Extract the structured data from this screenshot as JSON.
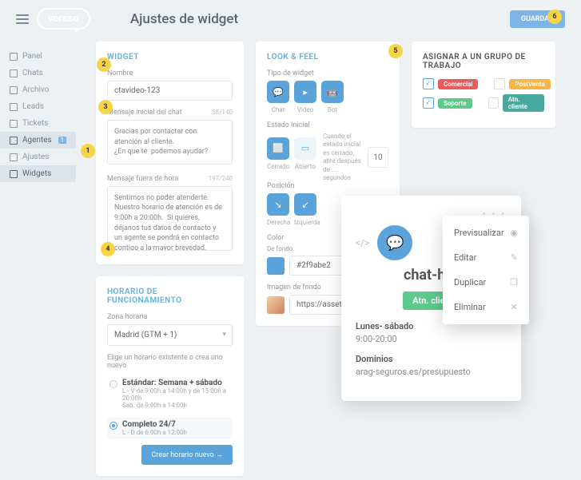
{
  "header": {
    "brand": "versso",
    "page_title": "Ajustes de widget",
    "save": "GUARDAR"
  },
  "nav": [
    {
      "label": "Panel"
    },
    {
      "label": "Chats"
    },
    {
      "label": "Archivo"
    },
    {
      "label": "Leads"
    },
    {
      "label": "Tickets"
    },
    {
      "label": "Agentes",
      "badge": "1",
      "active": true
    },
    {
      "label": "Ajustes"
    },
    {
      "label": "Widgets",
      "active": true
    }
  ],
  "widget": {
    "title": "WIDGET",
    "name_label": "Nombre",
    "name_value": "ctavideo-123",
    "msg_init_label": "Mensaje inicial del chat",
    "msg_init_count": "58/140",
    "msg_init_value": "Gracias por contactar con atención al cliente.\n¿En que te  podemos ayudar?",
    "msg_away_label": "Mensaje fuera de hora",
    "msg_away_count": "197/240",
    "msg_away_value": "Sentimos no poder atenderte. Nuestro horario de atención es de 9:00h a 20:00h.  Si quieres, déjanos tus datos de contacto y un agente se pondrá en contacto contigo a la mayor brevedad."
  },
  "schedule": {
    "title": "HORARIO DE FUNCIONAMIENTO",
    "tz_label": "Zona horaria",
    "tz_value": "Madrid (GTM + 1)",
    "choose": "Elige un horario existente o crea uno nuevo",
    "opt1": "Estándar: Semana + sábado",
    "opt1_sub1": "L - V de 9:00h a 14:00h y de 15:00h a 20:00h",
    "opt1_sub2": "Sab. de 9:00h a 14:00h",
    "opt2": "Completo 24/7",
    "opt2_sub": "L - D de 6:00h a 12:00h",
    "btn": "Crear horario nuevo  →"
  },
  "look": {
    "title": "LOOK & FEEL",
    "type_label": "Tipo de widget",
    "types": [
      "Chat",
      "Video",
      "Bot"
    ],
    "state_label": "Estado Inicial",
    "states": [
      "Cerrado",
      "Abierto"
    ],
    "state_desc": "Cuando el estado inicial es cerrado, abre después de .... segundos",
    "state_num": "10",
    "pos_label": "Posición",
    "positions": [
      "Derecha",
      "Izquierda"
    ],
    "color_label": "Color",
    "color_sub": "De fondo",
    "color_val": "#2f9abe2",
    "img_label": "Imagen de fondo",
    "img_url": "https://assets.livech"
  },
  "assign": {
    "title": "ASIGNAR A UN GRUPO DE TRABAJO",
    "groups": [
      {
        "label": "Comercial",
        "color": "red",
        "checked": true
      },
      {
        "label": "PostVenta",
        "color": "yellow",
        "checked": false
      },
      {
        "label": "Soporte",
        "color": "green",
        "checked": true
      },
      {
        "label": "Atn. cliente",
        "color": "teal",
        "checked": false
      }
    ]
  },
  "preview": {
    "code": "</>",
    "title": "chat-hor",
    "tag": "Atn. clien",
    "hours_label": "Lunes- sábado",
    "hours_val": "9:00-20:00",
    "domains_label": "Dominios",
    "domains_val": "arag-seguros.es/presupuesto"
  },
  "menu": [
    {
      "label": "Previsualizar",
      "icon": "◉"
    },
    {
      "label": "Editar",
      "icon": "✎"
    },
    {
      "label": "Duplicar",
      "icon": "❐"
    },
    {
      "label": "Eliminar",
      "icon": "✕"
    }
  ],
  "badges": {
    "1": "1",
    "2": "2",
    "3": "3",
    "4": "4",
    "5": "5",
    "6": "6"
  }
}
